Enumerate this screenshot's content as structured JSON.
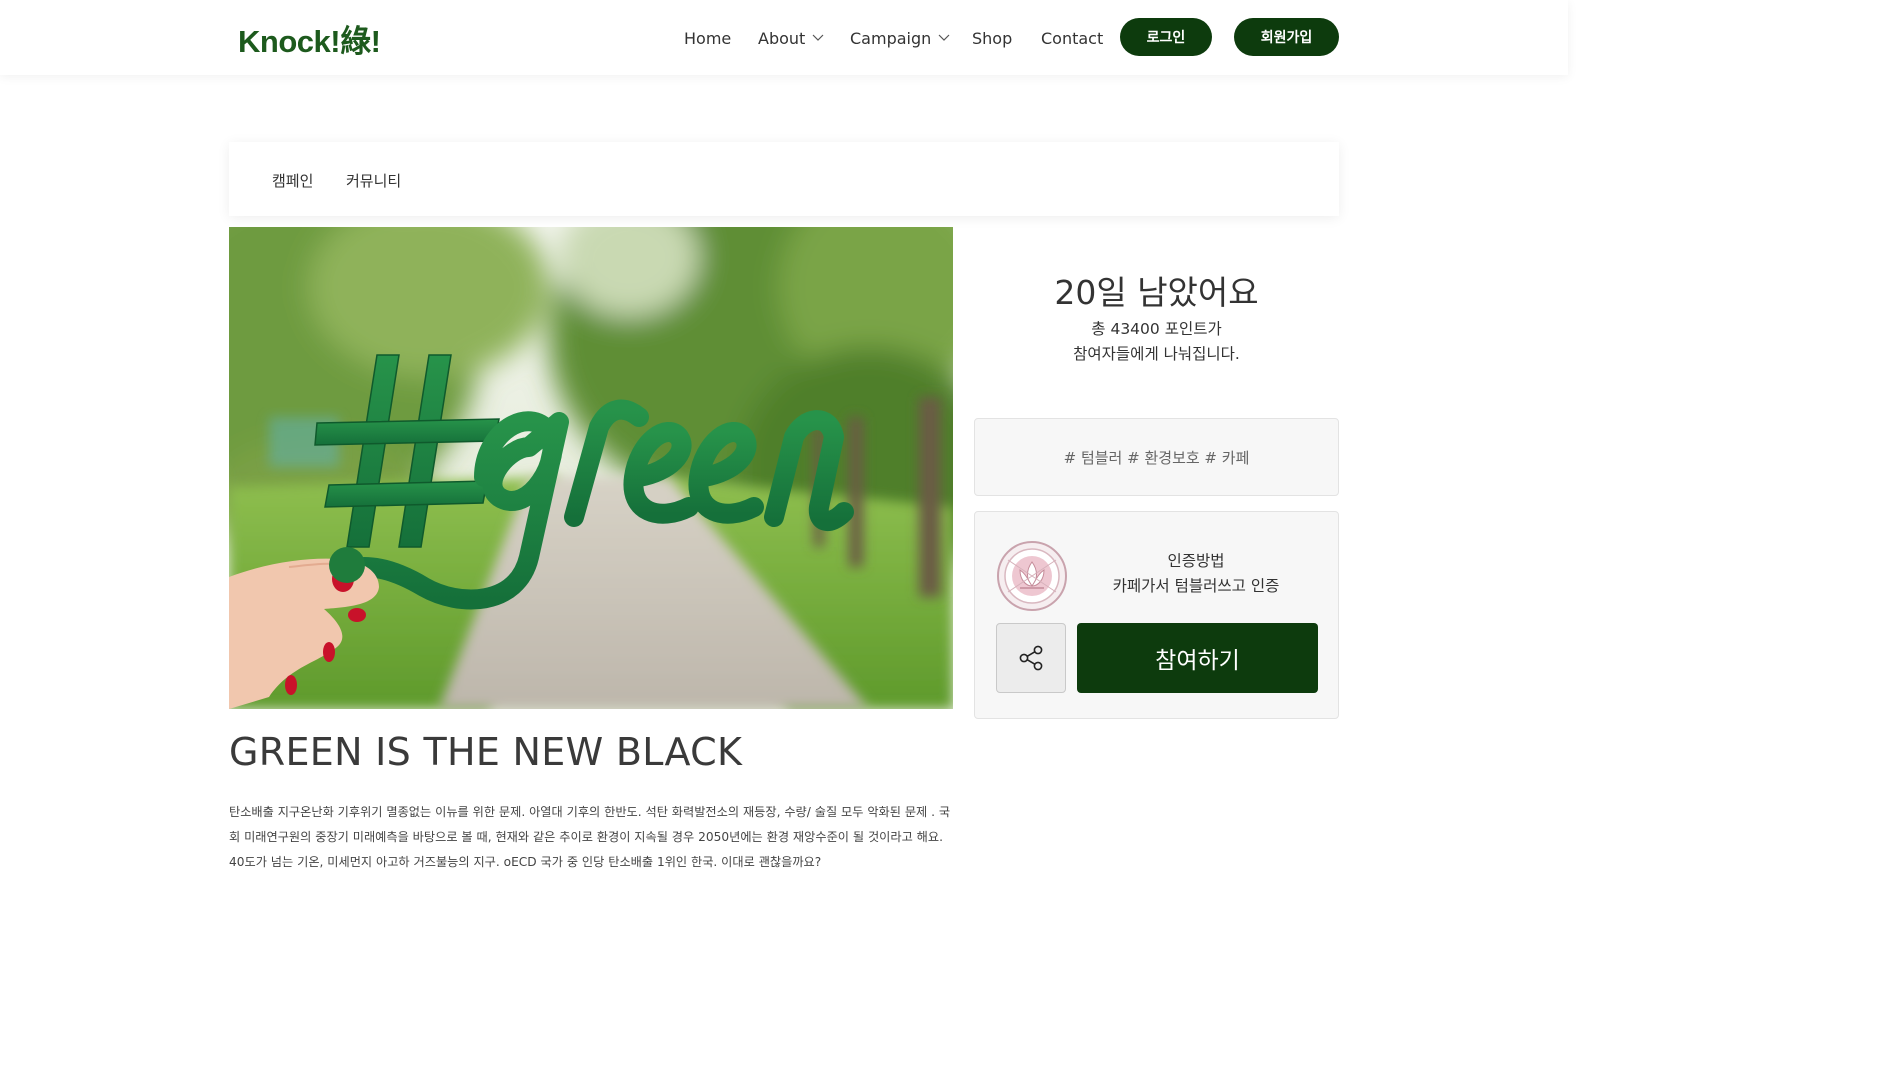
{
  "header": {
    "logo": "Knock!綠!",
    "nav": {
      "home": "Home",
      "about": "About",
      "campaign": "Campaign",
      "shop": "Shop",
      "contact": "Contact"
    },
    "login_label": "로그인",
    "signup_label": "회원가입",
    "brand_color": "#0d3b0d"
  },
  "subnav": {
    "tabs": [
      "캠페인",
      "커뮤니티"
    ]
  },
  "hero": {
    "image_text": "#green",
    "icon": "green-hashtag-photo"
  },
  "post": {
    "title": "GREEN IS THE NEW BLACK",
    "body": "탄소배출 지구온난화 기후위기 멸종없는 이뉴를 위한 문제. 아열대 기후의 한반도. 석탄 화력발전소의 재등장, 수량/ 술질 모두 악화된 문제 . 국회 미래연구원의 중장기 미래예측을 바탕으로 볼 때, 현재와 같은 추이로 환경이 지속될 경우 2050년에는 환경 재앙수준이 될 것이라고 해요. 40도가 넘는 기온, 미세먼지 아고하 거즈불능의 지구. oECD 국가 중 인당 탄소배출 1위인 한국. 이대로 괜찮을까요?"
  },
  "sidebar": {
    "days_left": "20일 남았어요",
    "points_line1": "총 43400 포인트가",
    "points_line2": "참여자들에게 나눠집니다.",
    "tags": "# 텀블러 # 환경보호 # 카페",
    "cert_title": "인증방법",
    "cert_desc": "카페가서 텀블러쓰고 인증",
    "badge_icon": "lotus-badge-icon",
    "share_icon": "share-icon",
    "join_label": "참여하기"
  }
}
